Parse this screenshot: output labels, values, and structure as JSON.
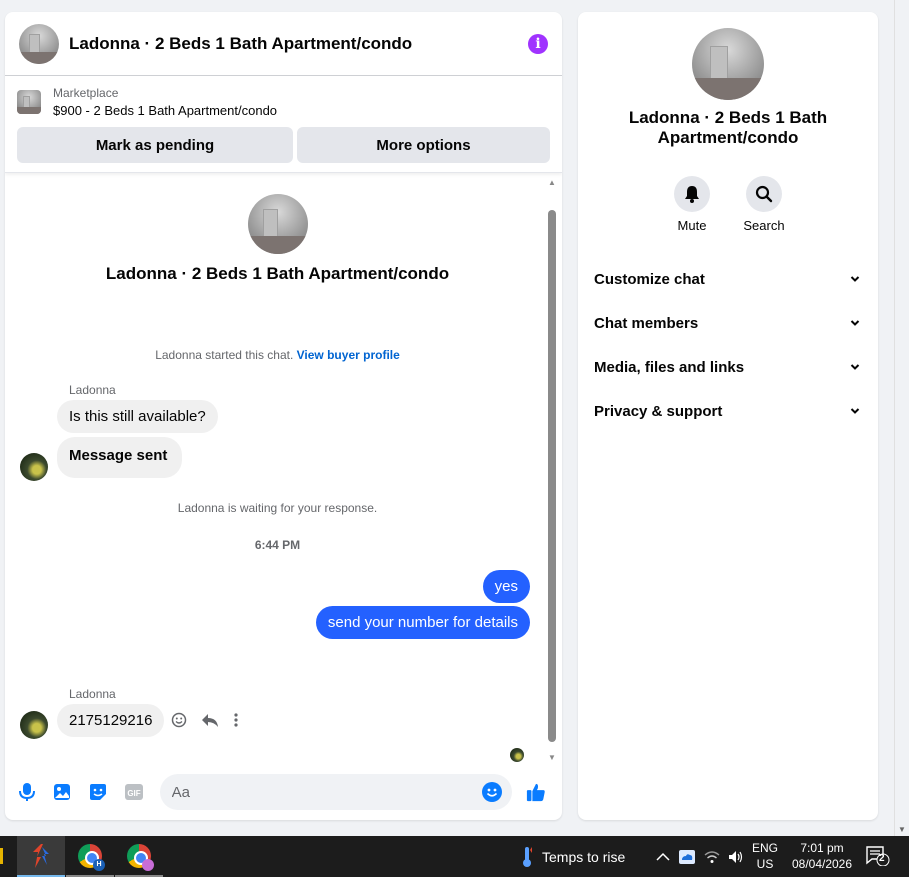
{
  "chat": {
    "title": "Ladonna · 2 Beds 1 Bath Apartment/condo",
    "marketplace_label": "Marketplace",
    "listing": "$900 - 2 Beds 1 Bath Apartment/condo",
    "mark_pending": "Mark as pending",
    "more_options": "More options",
    "intro_title": "Ladonna · 2 Beds 1 Bath Apartment/condo",
    "started_text": "Ladonna started this chat.",
    "buyer_profile_link": "View buyer profile",
    "sender": "Ladonna",
    "msg1": "Is this still available?",
    "msg2": "Message sent",
    "waiting": "Ladonna is waiting for your response.",
    "time": "6:44 PM",
    "out1": "yes",
    "out2": "send your number for details",
    "sender2": "Ladonna",
    "msg3": "2175129216",
    "input_placeholder": "Aa"
  },
  "info": {
    "title": "Ladonna · 2 Beds 1 Bath Apartment/condo",
    "mute": "Mute",
    "search": "Search",
    "sections": [
      "Customize chat",
      "Chat members",
      "Media, files and links",
      "Privacy & support"
    ]
  },
  "taskbar": {
    "weather": "Temps to rise",
    "lang1": "ENG",
    "lang2": "US",
    "time": "7:01 pm",
    "date": "08/04/2026",
    "notif_count": "2",
    "chrome_badge_1": "H"
  },
  "colors": {
    "accent": "#2461ff",
    "info": "#a033ff",
    "link": "#0064d1"
  }
}
